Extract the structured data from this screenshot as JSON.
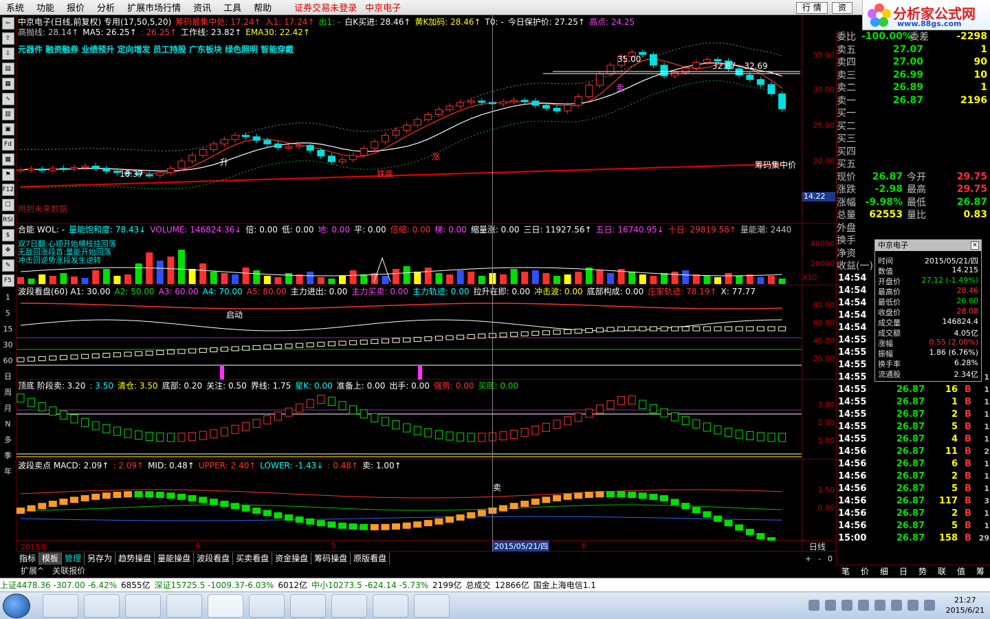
{
  "menu": {
    "items": [
      "系统",
      "功能",
      "报价",
      "分析",
      "扩展市场行情",
      "资讯",
      "工具",
      "帮助"
    ],
    "warning": "证券交易未登录",
    "stock_name": "中京电子",
    "btn_quote": "行 情",
    "btn_trade": "资"
  },
  "logo": {
    "title": "分析家公式网",
    "url": "www.88gs.com",
    "bg_code": "002579"
  },
  "left_toolbar": {
    "icons": [
      "left-arrow-icon",
      "up-arrow-icon",
      "down-arrow-icon",
      "chart-icon",
      "grid-icon",
      "line-icon",
      "bar-icon",
      "book-icon",
      "fund-icon",
      "excel-icon",
      "flag-icon",
      "f12-icon",
      "cost-icon",
      "rsi-icon",
      "dollar-icon",
      "move-icon",
      "pen-icon",
      "f5-icon"
    ],
    "icon_labels": [
      "⇦",
      "⇧",
      "⇩",
      "▤",
      "▦",
      "∿",
      "▥",
      "▣",
      "Fd",
      "▩",
      "⚑",
      "F12",
      "☐",
      "RSI",
      "$",
      "✥",
      "✎",
      "F5"
    ],
    "periods": [
      "1",
      "5",
      "15",
      "30",
      "60",
      "日",
      "周",
      "月",
      "N",
      "多",
      "季",
      "年"
    ]
  },
  "main_panel": {
    "title": "中京电子(日线,前复权) 专用(17,50,5,20)",
    "labels": [
      {
        "t": "筹码最集中处: 17.24↑",
        "c": "red"
      },
      {
        "t": "入1: 17.24↑",
        "c": "red"
      },
      {
        "t": "出1: -",
        "c": "green"
      },
      {
        "t": "白K买进: 28.46↑",
        "c": "white"
      },
      {
        "t": "黄K加码: 28.46↑",
        "c": "yellow"
      },
      {
        "t": "T0: -",
        "c": "white"
      },
      {
        "t": "今日保护价: 27.25↑",
        "c": "white"
      },
      {
        "t": "高点: 24.25",
        "c": "mag"
      }
    ],
    "labels2": [
      {
        "t": "高抛线: 28.14↑",
        "c": "gray"
      },
      {
        "t": "MA5: 26.25↑",
        "c": "white"
      },
      {
        "t": ": 26.25↑",
        "c": "red"
      },
      {
        "t": "工作线: 23.82↑",
        "c": "white"
      },
      {
        "t": "EMA30: 22.42↑",
        "c": "yellow"
      }
    ],
    "concepts": "元器件 融资融券 业绩预升 定向增发 员工持股 广东板块 绿色照明 智能穿戴",
    "future_data": "用到未来数据",
    "anno_range": "32.87 - 32.69",
    "anno_high": "35.00",
    "anno_low": "18.37",
    "anno_chip": "筹码集中价",
    "anno_tiedi": "铁底",
    "anno_sell": "卖",
    "anno_sheng": "升",
    "anno_zhang": "涨",
    "current_price_box": "14.22",
    "ticks": [
      "35.00",
      "30.00",
      "25.00",
      "20.00"
    ]
  },
  "vol_panel": {
    "labels": [
      {
        "t": "合能 WOL: -",
        "c": "white"
      },
      {
        "t": "量能饱和度: 78.43↓",
        "c": "cyan"
      },
      {
        "t": "VOLUME: 146824.36↓",
        "c": "mag"
      },
      {
        "t": "倍: 0.00",
        "c": "white"
      },
      {
        "t": "低: 0.00",
        "c": "white"
      },
      {
        "t": "地: 0.00",
        "c": "mag"
      },
      {
        "t": "平: 0.00",
        "c": "white"
      },
      {
        "t": "倍缩: 0.00",
        "c": "red"
      },
      {
        "t": "梯: 0.00",
        "c": "mag"
      },
      {
        "t": "缩量涨: 0.00",
        "c": "white"
      },
      {
        "t": "三日: 11927.56↑",
        "c": "white"
      },
      {
        "t": "五日: 16740.95↓",
        "c": "mag"
      },
      {
        "t": "十日: 29819.58↑",
        "c": "red"
      },
      {
        "t": "量能潮: 2440",
        "c": "gray"
      }
    ],
    "notes": [
      "双7日翻:心顺开始横枝挂回落",
      "无敌回涨段首:量能开始回落",
      "冲击回逆势涨段发生逆转"
    ],
    "ticks": [
      "40000",
      "20000"
    ],
    "x10": "X10"
  },
  "wave_panel": {
    "labels": [
      {
        "t": "波段看盘(60) A1: 30.00",
        "c": "white"
      },
      {
        "t": "A2: 50.00",
        "c": "green"
      },
      {
        "t": "A3: 60.00",
        "c": "mag"
      },
      {
        "t": "A4: 70.00",
        "c": "cyan"
      },
      {
        "t": "A5: 80.00",
        "c": "red"
      },
      {
        "t": "主力进出: 0.00",
        "c": "white"
      },
      {
        "t": "主力买卖: 0.00",
        "c": "mag"
      },
      {
        "t": "主力轨迹: 0.00",
        "c": "cyan"
      },
      {
        "t": "拉升在即: 0.00",
        "c": "white"
      },
      {
        "t": "冲击波: 0.00",
        "c": "yellow"
      },
      {
        "t": "底部构成: 0.00",
        "c": "white"
      },
      {
        "t": "庄家轨迹: 78.19↑",
        "c": "red"
      },
      {
        "t": "X: 77.77",
        "c": "white"
      }
    ],
    "qidong": "启动",
    "ticks": [
      "80.00",
      "60.00",
      "40.00",
      "20.00"
    ]
  },
  "top_bottom_panel": {
    "labels": [
      {
        "t": "顶底 阶段卖: 3.20",
        "c": "white"
      },
      {
        "t": ": 3.50",
        "c": "cyan"
      },
      {
        "t": "清仓: 3.50",
        "c": "yellow"
      },
      {
        "t": "底部: 0.20",
        "c": "white"
      },
      {
        "t": "关注: 0.50",
        "c": "white"
      },
      {
        "t": "界线: 1.75",
        "c": "white"
      },
      {
        "t": "星K: 0.00",
        "c": "cyan"
      },
      {
        "t": "准备上: 0.00",
        "c": "white"
      },
      {
        "t": "出手: 0.00",
        "c": "white"
      },
      {
        "t": "强势: 0.00",
        "c": "red"
      },
      {
        "t": "买底: 0.00",
        "c": "green"
      }
    ],
    "ticks": [
      "3.00",
      "2.00",
      "1.00"
    ]
  },
  "macd_panel": {
    "labels": [
      {
        "t": "波段卖点 MACD: 2.09↑",
        "c": "white"
      },
      {
        "t": ": 2.09↑",
        "c": "red"
      },
      {
        "t": "MID: 0.48↑",
        "c": "white"
      },
      {
        "t": "UPPER: 2.40↑",
        "c": "red"
      },
      {
        "t": "LOWER: -1.43↓",
        "c": "cyan"
      },
      {
        "t": ": 0.48↑",
        "c": "red"
      },
      {
        "t": "卖: 1.00↑",
        "c": "white"
      }
    ],
    "sell_tag": "卖",
    "ticks": [
      "1.50",
      "0.00"
    ]
  },
  "date_axis": {
    "labels": [
      "2015年",
      "4",
      "5",
      "6"
    ],
    "cursor": "2015/05/21/四",
    "period": "日线"
  },
  "bottom_tabs": [
    "指标",
    "模板",
    "管理",
    "另存为",
    "趋势操盘",
    "量能操盘",
    "波段看盘",
    "买卖看盘",
    "资金操盘",
    "筹码操盘",
    "原版看盘"
  ],
  "sub_tabs": [
    "扩展^",
    "关联报价"
  ],
  "quote": {
    "weibi": {
      "k": "委比",
      "v": "-100.00%",
      "k2": "委差",
      "v2": "-2298"
    },
    "sells": [
      {
        "k": "卖五",
        "p": "27.07",
        "q": "1"
      },
      {
        "k": "卖四",
        "p": "27.00",
        "q": "90"
      },
      {
        "k": "卖三",
        "p": "26.99",
        "q": "10"
      },
      {
        "k": "卖二",
        "p": "26.89",
        "q": "1"
      },
      {
        "k": "卖一",
        "p": "26.87",
        "q": "2196"
      }
    ],
    "buys": [
      "买一",
      "买二",
      "买三",
      "买四",
      "买五"
    ],
    "stats": [
      {
        "k": "现价",
        "v": "26.87",
        "k2": "今开",
        "v2": "29.75",
        "c1": "green",
        "c2": "red"
      },
      {
        "k": "涨跌",
        "v": "-2.98",
        "k2": "最高",
        "v2": "29.75",
        "c1": "green",
        "c2": "red"
      },
      {
        "k": "涨幅",
        "v": "-9.98%",
        "k2": "最低",
        "v2": "26.87",
        "c1": "green",
        "c2": "green"
      },
      {
        "k": "总量",
        "v": "62553",
        "k2": "量比",
        "v2": "0.83",
        "c1": "yellow",
        "c2": "yellow"
      },
      {
        "k": "外盘",
        "v": "",
        "k2": "",
        "v2": "",
        "c1": "red",
        "c2": "red"
      },
      {
        "k": "换手",
        "v": "",
        "k2": "",
        "v2": "",
        "c1": "yellow",
        "c2": "yellow"
      },
      {
        "k": "净资",
        "v": "",
        "k2": "",
        "v2": "",
        "c1": "yellow",
        "c2": "yellow"
      },
      {
        "k": "收益(一)",
        "v": "",
        "k2": "",
        "v2": "",
        "c1": "yellow",
        "c2": "yellow"
      }
    ]
  },
  "ticks_list": [
    {
      "t": "14:54",
      "p": "",
      "v": "",
      "b": "",
      "n": ""
    },
    {
      "t": "14:54",
      "p": "",
      "v": "",
      "b": "",
      "n": ""
    },
    {
      "t": "14:54",
      "p": "",
      "v": "",
      "b": "",
      "n": ""
    },
    {
      "t": "14:54",
      "p": "",
      "v": "",
      "b": "",
      "n": ""
    },
    {
      "t": "14:54",
      "p": "",
      "v": "",
      "b": "",
      "n": ""
    },
    {
      "t": "14:55",
      "p": "",
      "v": "",
      "b": "",
      "n": ""
    },
    {
      "t": "14:55",
      "p": "",
      "v": "",
      "b": "",
      "n": ""
    },
    {
      "t": "14:55",
      "p": "",
      "v": "",
      "b": "",
      "n": ""
    },
    {
      "t": "14:55",
      "p": "26.87",
      "v": "3",
      "b": "B",
      "n": "1"
    },
    {
      "t": "14:55",
      "p": "26.87",
      "v": "16",
      "b": "B",
      "n": "1"
    },
    {
      "t": "14:55",
      "p": "26.87",
      "v": "1",
      "b": "B",
      "n": "1"
    },
    {
      "t": "14:55",
      "p": "26.87",
      "v": "2",
      "b": "B",
      "n": "1"
    },
    {
      "t": "14:55",
      "p": "26.87",
      "v": "5",
      "b": "B",
      "n": "1"
    },
    {
      "t": "14:55",
      "p": "26.87",
      "v": "4",
      "b": "B",
      "n": "1"
    },
    {
      "t": "14:56",
      "p": "26.87",
      "v": "11",
      "b": "B",
      "n": "2"
    },
    {
      "t": "14:56",
      "p": "26.87",
      "v": "6",
      "b": "B",
      "n": "1"
    },
    {
      "t": "14:56",
      "p": "26.87",
      "v": "2",
      "b": "B",
      "n": "1"
    },
    {
      "t": "14:56",
      "p": "26.87",
      "v": "5",
      "b": "B",
      "n": "1"
    },
    {
      "t": "14:56",
      "p": "26.87",
      "v": "117",
      "b": "B",
      "n": "3"
    },
    {
      "t": "14:56",
      "p": "26.87",
      "v": "2",
      "b": "B",
      "n": "1"
    },
    {
      "t": "14:56",
      "p": "26.87",
      "v": "5",
      "b": "B",
      "n": "1"
    },
    {
      "t": "15:00",
      "p": "26.87",
      "v": "158",
      "b": "B",
      "n": "29"
    }
  ],
  "right_tabs": [
    "笔",
    "价",
    "细",
    "日",
    "势",
    "联",
    "值",
    "筹"
  ],
  "popup": {
    "title": "中京电子",
    "rows": [
      {
        "k": "时间",
        "v": "2015/05/21/四",
        "c": "white"
      },
      {
        "k": "数值",
        "v": "14.215",
        "c": "white"
      },
      {
        "k": "开盘价",
        "v": "27.12 (-1.49%)",
        "c": "green"
      },
      {
        "k": "最高价",
        "v": "28.46",
        "c": "red"
      },
      {
        "k": "最低价",
        "v": "26.60",
        "c": "green"
      },
      {
        "k": "收盘价",
        "v": "28.08",
        "c": "red"
      },
      {
        "k": "成交量",
        "v": "146824.4",
        "c": "white"
      },
      {
        "k": "成交额",
        "v": "4.05亿",
        "c": "white"
      },
      {
        "k": "涨幅",
        "v": "0.55 (2.00%)",
        "c": "red"
      },
      {
        "k": "振幅",
        "v": "1.86 (6.76%)",
        "c": "white"
      },
      {
        "k": "换手率",
        "v": "6.28%",
        "c": "white"
      },
      {
        "k": "流通股",
        "v": "2.34亿",
        "c": "white"
      }
    ]
  },
  "statusbar": [
    {
      "t": "上证4478.36 -307.00 -6.42%",
      "c": "#008000"
    },
    {
      "t": "6855亿",
      "c": "#000"
    },
    {
      "t": "深证15725.5 -1009.37-6.03%",
      "c": "#008000"
    },
    {
      "t": "6012亿",
      "c": "#000"
    },
    {
      "t": "中小10273.5 -624.14 -5.73%",
      "c": "#008000"
    },
    {
      "t": "2199亿",
      "c": "#000"
    },
    {
      "t": "总成交",
      "c": "#000"
    },
    {
      "t": "12866亿",
      "c": "#000"
    },
    {
      "t": "国金上海电信1.1",
      "c": "#000"
    }
  ],
  "clock": {
    "time": "21:27",
    "date": "2015/6/21"
  },
  "colors": {
    "up": "#ff3030",
    "down": "#00e0e0",
    "bg": "#000000",
    "grid": "#700000"
  }
}
